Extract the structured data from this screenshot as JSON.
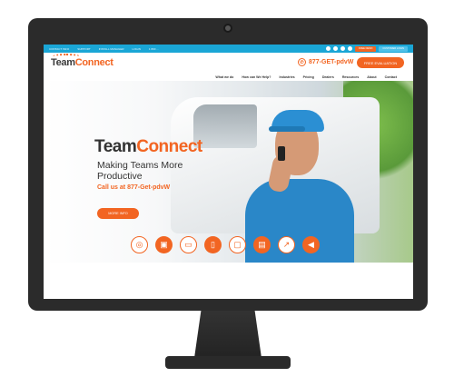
{
  "topbar": {
    "links": [
      "CONTACT INFO",
      "SUPPORT",
      "INSTALL MANAGER",
      "LOGIN"
    ],
    "phone_note": "1 800 ...",
    "btn1": "FREE DEMO",
    "btn2": "CUSTOMER LOGIN",
    "colors": {
      "bar": "#1aa6d6",
      "orange": "#f26522"
    }
  },
  "header": {
    "logo_team": "Team",
    "logo_connect": "Connect",
    "phone": "877-GET-pdvW",
    "cta": "FREE EVALUATION"
  },
  "nav": {
    "items": [
      "What we do",
      "How can We Help?",
      "Industries",
      "Pricing",
      "Dealers",
      "Resources",
      "About",
      "Contact"
    ]
  },
  "hero": {
    "title_team": "Team",
    "title_connect": "Connect",
    "subtitle": "Making Teams More Productive",
    "call": "Call us at 877-Get-pdvW",
    "more_button": "MORE INFO"
  },
  "feature_icons": [
    {
      "name": "globe-icon",
      "glyph": "◎",
      "style": "w"
    },
    {
      "name": "calendar-icon",
      "glyph": "▣",
      "style": "o"
    },
    {
      "name": "monitor-icon",
      "glyph": "▭",
      "style": "w"
    },
    {
      "name": "mobile-icon",
      "glyph": "▯",
      "style": "o"
    },
    {
      "name": "clipboard-icon",
      "glyph": "▢",
      "style": "w"
    },
    {
      "name": "chat-icon",
      "glyph": "▤",
      "style": "o"
    },
    {
      "name": "chart-icon",
      "glyph": "↗",
      "style": "w"
    },
    {
      "name": "megaphone-icon",
      "glyph": "◀",
      "style": "o"
    }
  ]
}
